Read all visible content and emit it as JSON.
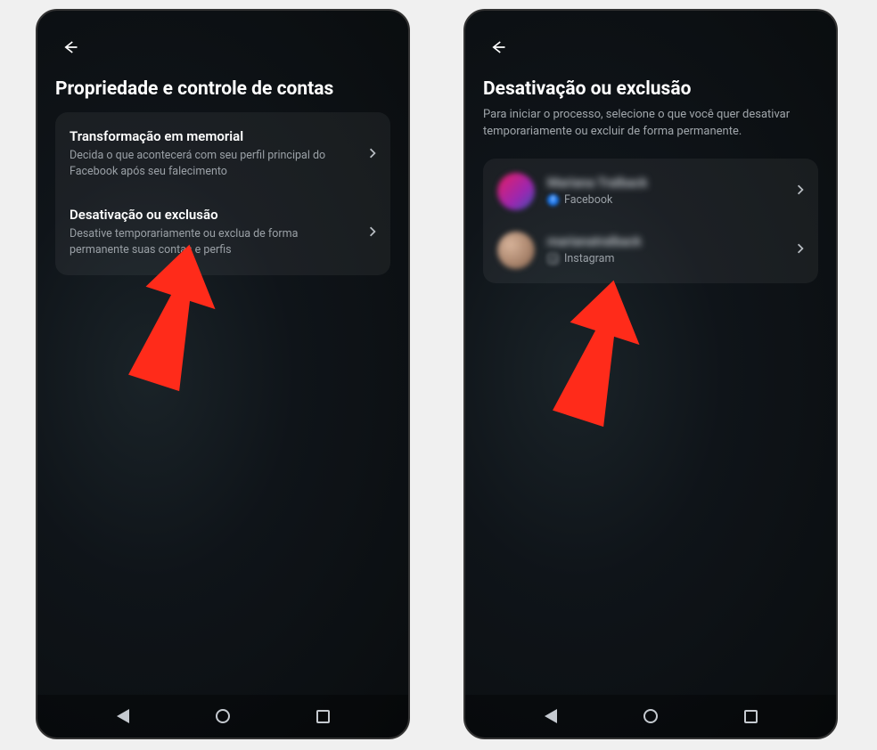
{
  "screen_left": {
    "title": "Propriedade e controle de contas",
    "items": [
      {
        "title": "Transformação em memorial",
        "desc": "Decida o que acontecerá com seu perfil principal do Facebook após seu falecimento"
      },
      {
        "title": "Desativação ou exclusão",
        "desc": "Desative temporariamente ou exclua de forma permanente suas contas e perfis"
      }
    ]
  },
  "screen_right": {
    "title": "Desativação ou exclusão",
    "desc": "Para iniciar o processo, selecione o que você quer desativar temporariamente ou excluir de forma permanente.",
    "accounts": [
      {
        "name": "Mariana Tralback",
        "platform": "Facebook"
      },
      {
        "name": "marianatralback",
        "platform": "Instagram"
      }
    ]
  }
}
